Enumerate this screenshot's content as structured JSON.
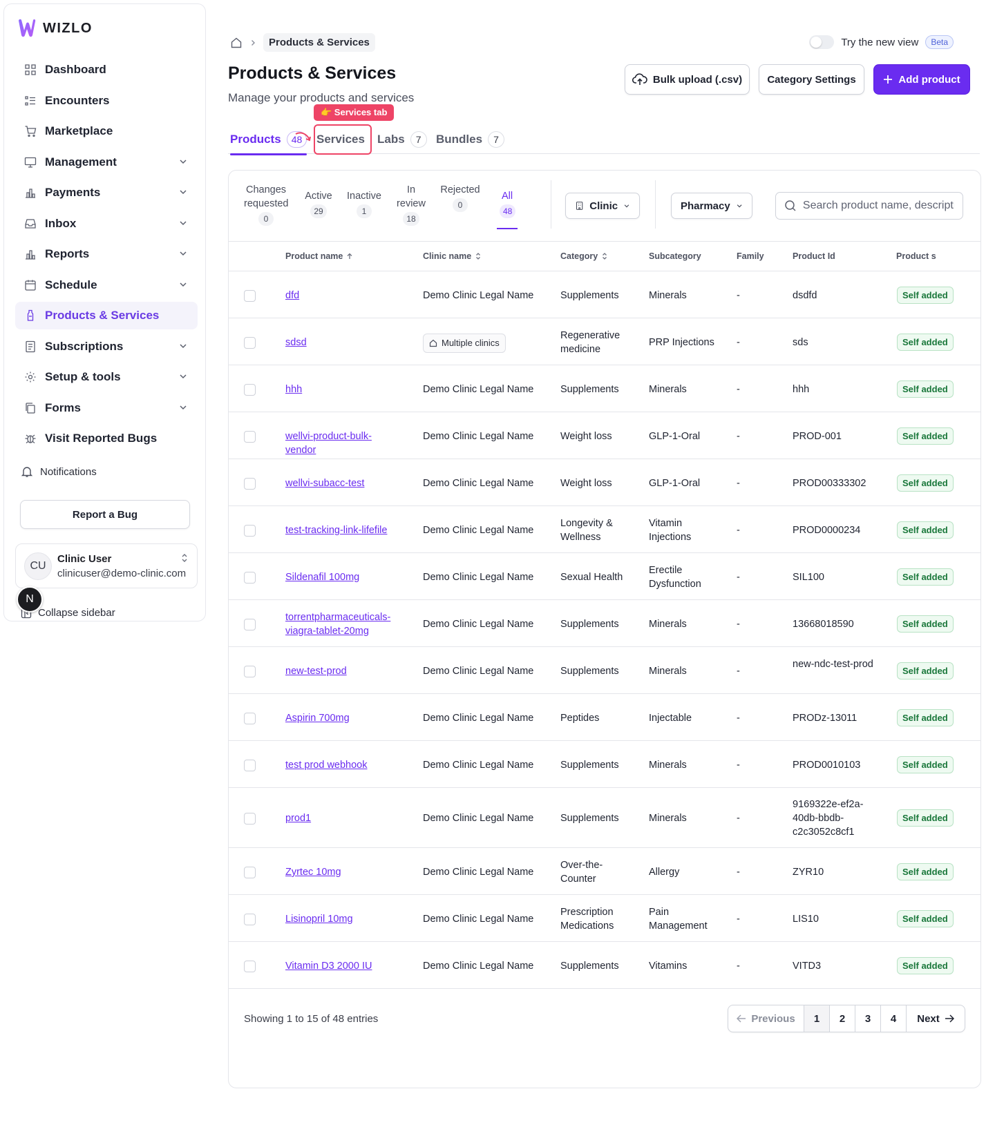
{
  "brand": {
    "name": "WIZLO"
  },
  "sidebar": {
    "items": [
      {
        "label": "Dashboard",
        "icon": "grid-icon",
        "has_chevron": false
      },
      {
        "label": "Encounters",
        "icon": "list-icon",
        "has_chevron": false
      },
      {
        "label": "Marketplace",
        "icon": "cart-icon",
        "has_chevron": false
      },
      {
        "label": "Management",
        "icon": "monitor-icon",
        "has_chevron": true
      },
      {
        "label": "Payments",
        "icon": "bar-chart-icon",
        "has_chevron": true
      },
      {
        "label": "Inbox",
        "icon": "inbox-icon",
        "has_chevron": true
      },
      {
        "label": "Reports",
        "icon": "bar-chart-icon",
        "has_chevron": true
      },
      {
        "label": "Schedule",
        "icon": "calendar-icon",
        "has_chevron": true
      },
      {
        "label": "Products & Services",
        "icon": "bottle-icon",
        "has_chevron": false,
        "active": true
      },
      {
        "label": "Subscriptions",
        "icon": "document-icon",
        "has_chevron": true
      },
      {
        "label": "Setup & tools",
        "icon": "gear-icon",
        "has_chevron": true
      },
      {
        "label": "Forms",
        "icon": "copy-icon",
        "has_chevron": true
      },
      {
        "label": "Visit Reported Bugs",
        "icon": "bug-icon",
        "has_chevron": false
      }
    ],
    "notifications_label": "Notifications",
    "report_bug_label": "Report a Bug",
    "user": {
      "initials": "CU",
      "name": "Clinic User",
      "email": "clinicuser@demo-clinic.com"
    },
    "collapse_label": "Collapse sidebar",
    "floating_badge": "N"
  },
  "header": {
    "breadcrumb_page": "Products & Services",
    "new_view_label": "Try the new view",
    "beta_label": "Beta",
    "title": "Products & Services",
    "subtitle": "Manage your products and services",
    "bulk_upload_label": "Bulk upload (.csv)",
    "category_settings_label": "Category Settings",
    "add_product_label": "Add product"
  },
  "tabs": [
    {
      "label": "Products",
      "count": "48",
      "active": true
    },
    {
      "label": "Services",
      "count": ""
    },
    {
      "label": "Labs",
      "count": "7"
    },
    {
      "label": "Bundles",
      "count": "7"
    }
  ],
  "annotation": {
    "tooltip": "👉 Services tab"
  },
  "status_filters": [
    {
      "label": "Changes requested",
      "count": "0"
    },
    {
      "label": "Active",
      "count": "29"
    },
    {
      "label": "Inactive",
      "count": "1"
    },
    {
      "label": "In review",
      "count": "18"
    },
    {
      "label": "Rejected",
      "count": "0"
    },
    {
      "label": "All",
      "count": "48",
      "active": true
    }
  ],
  "filters": {
    "clinic_label": "Clinic",
    "pharmacy_label": "Pharmacy",
    "search_placeholder": "Search product name, description"
  },
  "columns": [
    "Product name",
    "Clinic name",
    "Category",
    "Subcategory",
    "Family",
    "Product Id",
    "Product s"
  ],
  "rows": [
    {
      "name": "dfd",
      "clinic": "Demo Clinic Legal Name",
      "category": "Supplements",
      "subcategory": "Minerals",
      "family": "-",
      "product_id": "dsdfd",
      "status": "Self added"
    },
    {
      "name": "sdsd",
      "clinic": "Multiple clinics",
      "multi": true,
      "category": "Regenerative medicine",
      "subcategory": "PRP Injections",
      "family": "-",
      "product_id": "sds",
      "status": "Self added"
    },
    {
      "name": "hhh",
      "clinic": "Demo Clinic Legal Name",
      "category": "Supplements",
      "subcategory": "Minerals",
      "family": "-",
      "product_id": "hhh",
      "status": "Self added"
    },
    {
      "name": "wellvi-product-bulk-vendor",
      "clinic": "Demo Clinic Legal Name",
      "category": "Weight loss",
      "subcategory": "GLP-1-Oral",
      "family": "-",
      "product_id": "PROD-001",
      "status": "Self added"
    },
    {
      "name": "wellvi-subacc-test",
      "clinic": "Demo Clinic Legal Name",
      "category": "Weight loss",
      "subcategory": "GLP-1-Oral",
      "family": "-",
      "product_id": "PROD00333302",
      "status": "Self added"
    },
    {
      "name": "test-tracking-link-lifefile",
      "clinic": "Demo Clinic Legal Name",
      "category": "Longevity & Wellness",
      "subcategory": "Vitamin Injections",
      "family": "-",
      "product_id": "PROD0000234",
      "status": "Self added"
    },
    {
      "name": "Sildenafil 100mg",
      "clinic": "Demo Clinic Legal Name",
      "category": "Sexual Health",
      "subcategory": "Erectile Dysfunction",
      "family": "-",
      "product_id": "SIL100",
      "status": "Self added"
    },
    {
      "name": "torrentpharmaceuticals-viagra-tablet-20mg",
      "clinic": "Demo Clinic Legal Name",
      "category": "Supplements",
      "subcategory": "Minerals",
      "family": "-",
      "product_id": "13668018590",
      "status": "Self added"
    },
    {
      "name": "new-test-prod",
      "clinic": "Demo Clinic Legal Name",
      "category": "Supplements",
      "subcategory": "Minerals",
      "family": "-",
      "product_id": "new-ndc-test-prod",
      "status": "Self added"
    },
    {
      "name": "Aspirin 700mg",
      "clinic": "Demo Clinic Legal Name",
      "category": "Peptides",
      "subcategory": "Injectable",
      "family": "-",
      "product_id": "PRODz-13011",
      "status": "Self added"
    },
    {
      "name": "test prod webhook",
      "clinic": "Demo Clinic Legal Name",
      "category": "Supplements",
      "subcategory": "Minerals",
      "family": "-",
      "product_id": "PROD0010103",
      "status": "Self added"
    },
    {
      "name": "prod1",
      "clinic": "Demo Clinic Legal Name",
      "category": "Supplements",
      "subcategory": "Minerals",
      "family": "-",
      "product_id": "9169322e-ef2a-40db-bbdb-c2c3052c8cf1",
      "status": "Self added"
    },
    {
      "name": "Zyrtec 10mg",
      "clinic": "Demo Clinic Legal Name",
      "category": "Over-the-Counter",
      "subcategory": "Allergy",
      "family": "-",
      "product_id": "ZYR10",
      "status": "Self added"
    },
    {
      "name": "Lisinopril 10mg",
      "clinic": "Demo Clinic Legal Name",
      "category": "Prescription Medications",
      "subcategory": "Pain Management",
      "family": "-",
      "product_id": "LIS10",
      "status": "Self added"
    },
    {
      "name": "Vitamin D3 2000 IU",
      "clinic": "Demo Clinic Legal Name",
      "category": "Supplements",
      "subcategory": "Vitamins",
      "family": "-",
      "product_id": "VITD3",
      "status": "Self added"
    }
  ],
  "pagination": {
    "showing": "Showing 1 to 15 of 48 entries",
    "previous_label": "Previous",
    "next_label": "Next",
    "pages": [
      "1",
      "2",
      "3",
      "4"
    ],
    "current": "1"
  },
  "colors": {
    "accent": "#6a2cf0",
    "highlight": "#ee4466",
    "success": "#19773a"
  }
}
